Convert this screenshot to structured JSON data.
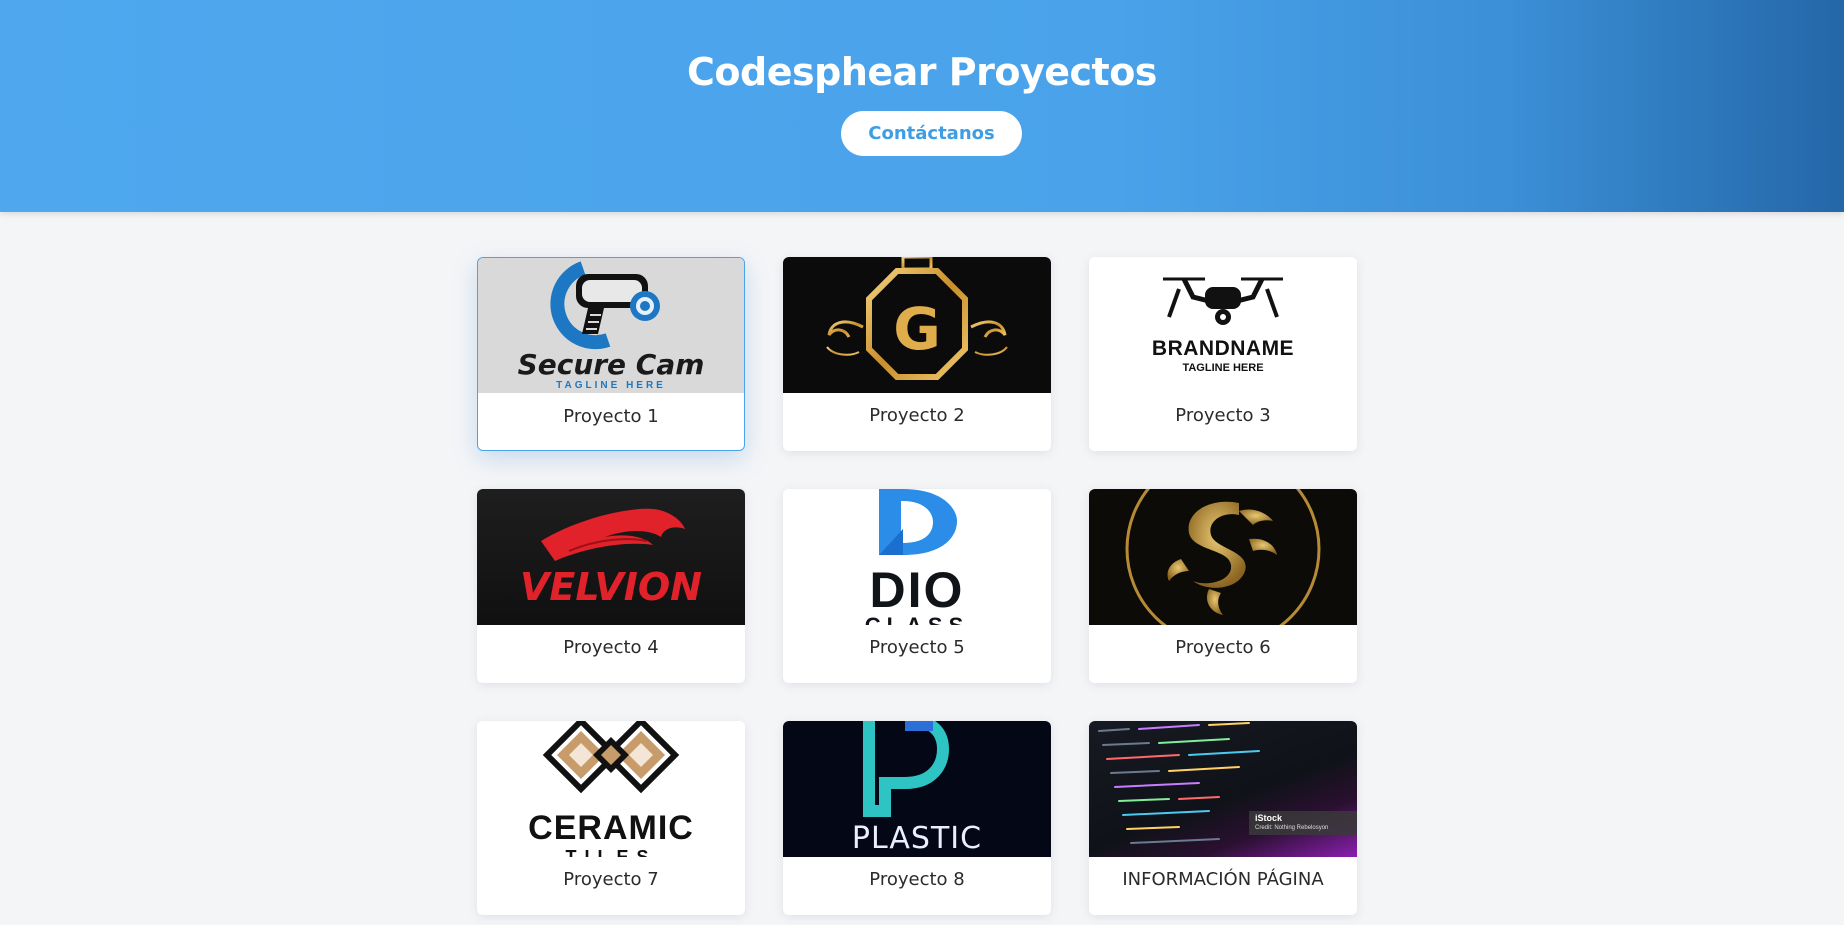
{
  "header": {
    "title": "Codesphear Proyectos",
    "contact_label": "Contáctanos"
  },
  "projects": [
    {
      "label": "Proyecto 1",
      "logo": {
        "name": "Secure Cam",
        "tagline": "TAGLINE HERE"
      }
    },
    {
      "label": "Proyecto 2",
      "logo": {
        "letter": "G"
      }
    },
    {
      "label": "Proyecto 3",
      "logo": {
        "name": "BRANDNAME",
        "tagline": "TAGLINE HERE"
      }
    },
    {
      "label": "Proyecto 4",
      "logo": {
        "name": "VELVION"
      }
    },
    {
      "label": "Proyecto 5",
      "logo": {
        "name": "DIO",
        "sub": "CLASS"
      }
    },
    {
      "label": "Proyecto 6",
      "logo": {
        "name": "dragon-emblem"
      }
    },
    {
      "label": "Proyecto 7",
      "logo": {
        "name": "CERAMIC",
        "sub": "TILES"
      }
    },
    {
      "label": "Proyecto 8",
      "logo": {
        "name": "PLASTIC"
      }
    },
    {
      "label": "INFORMACIÓN PÁGINA",
      "logo": {
        "name": "iStock",
        "caption": "Credit: Nothing Rebelosyon"
      }
    }
  ],
  "colors": {
    "header_start": "#4fa8ee",
    "header_end": "#2467a8",
    "accent": "#3d9ee6",
    "page_bg": "#f4f5f7"
  }
}
